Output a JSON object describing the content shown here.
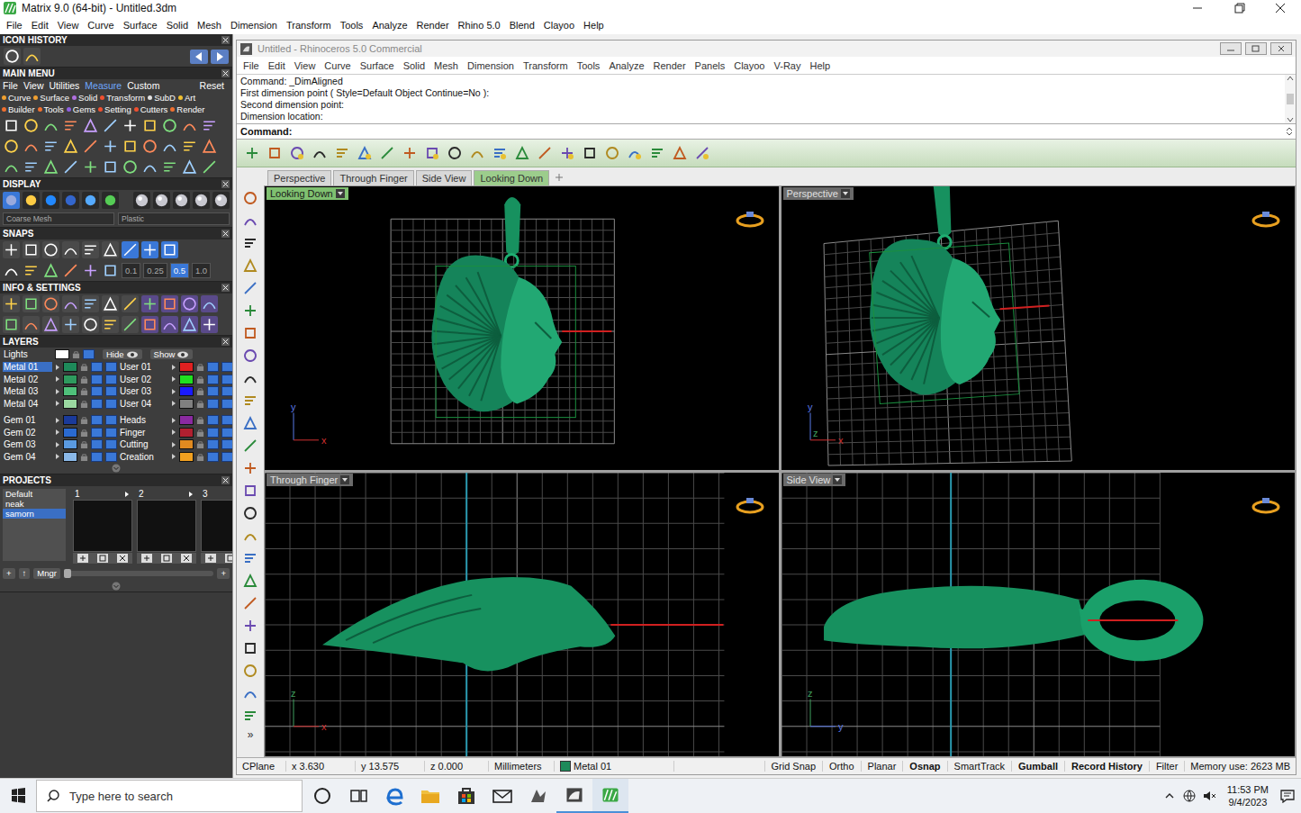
{
  "window": {
    "title": "Matrix 9.0 (64-bit) - Untitled.3dm"
  },
  "menu": [
    "File",
    "Edit",
    "View",
    "Curve",
    "Surface",
    "Solid",
    "Mesh",
    "Dimension",
    "Transform",
    "Tools",
    "Analyze",
    "Render",
    "Rhino 5.0",
    "Blend",
    "Clayoo",
    "Help"
  ],
  "left_panel": {
    "icon_history": {
      "title": "ICON HISTORY"
    },
    "main_menu": {
      "title": "MAIN MENU",
      "tabs": [
        {
          "label": "File",
          "selected": false
        },
        {
          "label": "View",
          "selected": false
        },
        {
          "label": "Utilities",
          "selected": false
        },
        {
          "label": "Measure",
          "selected": true
        },
        {
          "label": "Custom",
          "selected": false
        }
      ],
      "reset": "Reset",
      "category_rows": [
        [
          {
            "label": "Curve",
            "color": "#f0a030"
          },
          {
            "label": "Surface",
            "color": "#f0a030"
          },
          {
            "label": "Solid",
            "color": "#b070e0"
          },
          {
            "label": "Transform",
            "color": "#f05030"
          },
          {
            "label": "SubD",
            "color": "#e0e0e0"
          },
          {
            "label": "Art",
            "color": "#f0c030"
          }
        ],
        [
          {
            "label": "Builder",
            "color": "#f07030"
          },
          {
            "label": "Tools",
            "color": "#f07030"
          },
          {
            "label": "Gems",
            "color": "#9060e0"
          },
          {
            "label": "Setting",
            "color": "#f05030"
          },
          {
            "label": "Cutters",
            "color": "#f05030"
          },
          {
            "label": "Render",
            "color": "#f07030"
          }
        ]
      ]
    },
    "display": {
      "title": "DISPLAY",
      "mesh": "Coarse Mesh",
      "material": "Plastic"
    },
    "snaps": {
      "title": "SNAPS",
      "steps": [
        {
          "label": "0.1",
          "selected": false
        },
        {
          "label": "0.25",
          "selected": false
        },
        {
          "label": "0.5",
          "selected": true
        },
        {
          "label": "1.0",
          "selected": false
        }
      ]
    },
    "info": {
      "title": "INFO & SETTINGS"
    },
    "layers": {
      "title": "LAYERS",
      "lights": {
        "name": "Lights",
        "color": "#ffffff"
      },
      "hide": "Hide",
      "show": "Show",
      "columns": [
        [
          [
            {
              "name": "Metal 01",
              "color": "#1e8a5a",
              "selected": true
            },
            {
              "name": "Metal 02",
              "color": "#2e9a5e",
              "selected": false
            },
            {
              "name": "Metal 03",
              "color": "#4fc07a",
              "selected": false
            },
            {
              "name": "Metal 04",
              "color": "#9ad8a0",
              "selected": false
            }
          ],
          [
            {
              "name": "Gem 01",
              "color": "#1a3a9a",
              "selected": false
            },
            {
              "name": "Gem 02",
              "color": "#2a6ad0",
              "selected": false
            },
            {
              "name": "Gem 03",
              "color": "#5a9ae0",
              "selected": false
            },
            {
              "name": "Gem 04",
              "color": "#8ab8e8",
              "selected": false
            }
          ]
        ],
        [
          [
            {
              "name": "User 01",
              "color": "#e02020",
              "selected": false
            },
            {
              "name": "User 02",
              "color": "#20e020",
              "selected": false
            },
            {
              "name": "User 03",
              "color": "#1a1aff",
              "selected": false
            },
            {
              "name": "User 04",
              "color": "#808080",
              "selected": false
            }
          ],
          [
            {
              "name": "Heads",
              "color": "#8a2aa0",
              "selected": false
            },
            {
              "name": "Finger",
              "color": "#b02030",
              "selected": false
            },
            {
              "name": "Cutting",
              "color": "#e08a20",
              "selected": false
            },
            {
              "name": "Creation",
              "color": "#f0a020",
              "selected": false
            }
          ]
        ]
      ]
    },
    "projects": {
      "title": "PROJECTS",
      "items": [
        {
          "label": "Default",
          "selected": false
        },
        {
          "label": "neak",
          "selected": false
        },
        {
          "label": "samorn",
          "selected": true
        }
      ],
      "thumbnails": [
        {
          "number": "1"
        },
        {
          "number": "2"
        },
        {
          "number": "3"
        }
      ],
      "buttons": [
        "+",
        "↑",
        "Mngr"
      ],
      "zoom": {
        "level": 0
      },
      "add": "+"
    }
  },
  "rhino": {
    "title": "Untitled - Rhinoceros 5.0 Commercial",
    "menu": [
      "File",
      "Edit",
      "View",
      "Curve",
      "Surface",
      "Solid",
      "Mesh",
      "Dimension",
      "Transform",
      "Tools",
      "Analyze",
      "Render",
      "Panels",
      "Clayoo",
      "V-Ray",
      "Help"
    ],
    "history": [
      "Command: _DimAligned",
      "First dimension point ( Style=Default  Object  Continue=No ):",
      "Second dimension point:",
      "Dimension location:"
    ],
    "prompt": "Command:",
    "tabs": [
      {
        "label": "Perspective",
        "selected": false
      },
      {
        "label": "Through Finger",
        "selected": false
      },
      {
        "label": "Side View",
        "selected": false
      },
      {
        "label": "Looking Down",
        "selected": true
      }
    ],
    "toolbar_more": "»",
    "viewports": [
      {
        "label": "Looking Down",
        "kind": "top",
        "active": true,
        "axes": [
          "y",
          "x"
        ]
      },
      {
        "label": "Perspective",
        "kind": "perspective",
        "active": false,
        "axes": [
          "y",
          "z",
          "x"
        ]
      },
      {
        "label": "Through Finger",
        "kind": "front",
        "active": false,
        "axes": [
          "z",
          "x"
        ]
      },
      {
        "label": "Side View",
        "kind": "side",
        "active": false,
        "axes": [
          "z",
          "y"
        ]
      }
    ],
    "status": {
      "cplane": "CPlane",
      "x": "x 3.630",
      "y": "y 13.575",
      "z": "z 0.000",
      "units": "Millimeters",
      "layer": {
        "name": "Metal 01",
        "color": "#1e8a5a"
      },
      "toggles": [
        {
          "label": "Grid Snap",
          "on": false
        },
        {
          "label": "Ortho",
          "on": false
        },
        {
          "label": "Planar",
          "on": false
        },
        {
          "label": "Osnap",
          "on": true
        },
        {
          "label": "SmartTrack",
          "on": false
        },
        {
          "label": "Gumball",
          "on": true
        },
        {
          "label": "Record History",
          "on": true
        },
        {
          "label": "Filter",
          "on": false
        }
      ],
      "memory": "Memory use: 2623 MB"
    }
  },
  "taskbar": {
    "search": {
      "placeholder": "Type here to search"
    },
    "time": "11:53 PM",
    "date": "9/4/2023"
  }
}
